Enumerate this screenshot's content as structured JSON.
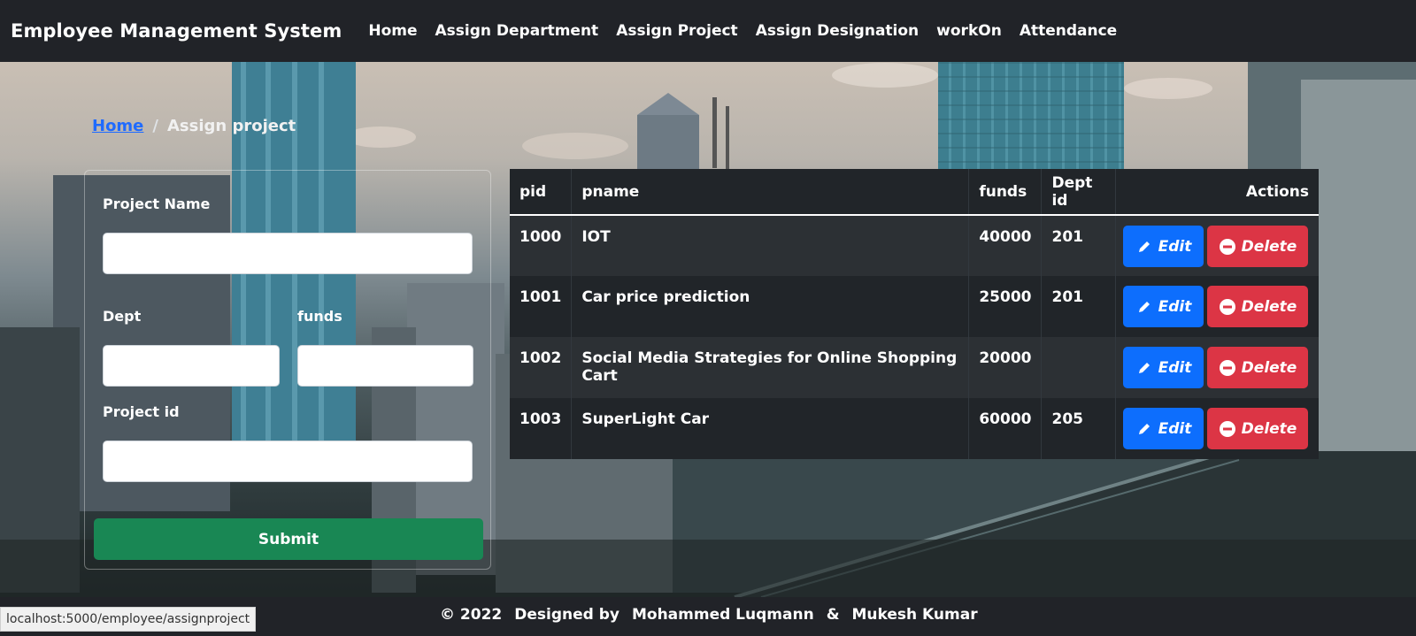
{
  "navbar": {
    "brand": "Employee Management System",
    "links": [
      "Home",
      "Assign Department",
      "Assign Project",
      "Assign Designation",
      "workOn",
      "Attendance"
    ]
  },
  "breadcrumb": {
    "home": "Home",
    "separator": "/",
    "current": "Assign project"
  },
  "form": {
    "project_name_label": "Project Name",
    "project_name_value": "",
    "dept_label": "Dept",
    "dept_value": "",
    "funds_label": "funds",
    "funds_value": "",
    "project_id_label": "Project id",
    "project_id_value": "",
    "submit_label": "Submit"
  },
  "table": {
    "headers": [
      "pid",
      "pname",
      "funds",
      "Dept id",
      "Actions"
    ],
    "rows": [
      {
        "pid": "1000",
        "pname": "IOT",
        "funds": "40000",
        "dept": "201"
      },
      {
        "pid": "1001",
        "pname": "Car price prediction",
        "funds": "25000",
        "dept": "201"
      },
      {
        "pid": "1002",
        "pname": "Social Media Strategies for Online Shopping Cart",
        "funds": "20000",
        "dept": ""
      },
      {
        "pid": "1003",
        "pname": "SuperLight Car",
        "funds": "60000",
        "dept": "205"
      }
    ],
    "edit_label": "Edit",
    "delete_label": "Delete",
    "edit_icon": "pencil-icon",
    "delete_icon": "minus-circle-icon"
  },
  "footer": {
    "copyright": "© 2022",
    "designed_by": "Designed by",
    "author1": "Mohammed Luqmann",
    "amp": "&",
    "author2": "Mukesh Kumar"
  },
  "status_url": "localhost:5000/employee/assignproject",
  "colors": {
    "navbar": "#212328",
    "edit": "#0d6efd",
    "delete": "#dc3545",
    "submit": "#198754",
    "link": "#1f6bff"
  }
}
